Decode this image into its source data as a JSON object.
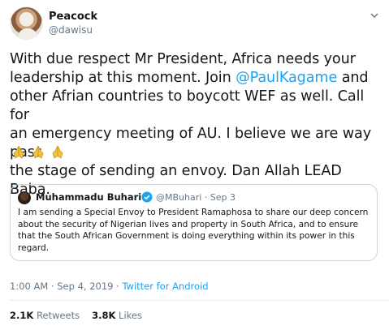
{
  "author": {
    "name": "Peacock",
    "handle": "@dawisu"
  },
  "tweet": {
    "line1": "With due respect Mr President, Africa needs your",
    "line2_pre": "leadership at this moment. Join ",
    "mention": "@PaulKagame",
    "line2_post": " and",
    "line3": "other Afrian countries to boycott WEF as well. Call for",
    "line4": "an emergency meeting of AU. I believe we are way pass",
    "line5": "the stage of sending an envoy. Dan Allah LEAD Baba.",
    "emojis": [
      "folded-hands-icon",
      "folded-hands-icon",
      "folded-hands-icon"
    ]
  },
  "quoted": {
    "name": "Muhammadu Buhari",
    "handle_date": "@MBuhari · Sep 3",
    "line1": "I am sending a Special Envoy to President Ramaphosa to share our deep concern",
    "line2": "about the security of Nigerian lives and property in South Africa, and to ensure",
    "line3": "that the South African Government is doing everything within its power in this",
    "line4": "regard."
  },
  "meta": {
    "timestamp": "1:00 AM · Sep 4, 2019 · ",
    "source": "Twitter for Android"
  },
  "stats": {
    "retweets_count": "2.1K",
    "retweets_label": "Retweets",
    "likes_count": "3.8K",
    "likes_label": "Likes"
  },
  "colors": {
    "accent": "#1da1f2",
    "muted": "#657786",
    "text": "#14171a",
    "border": "#ccd6dd"
  }
}
